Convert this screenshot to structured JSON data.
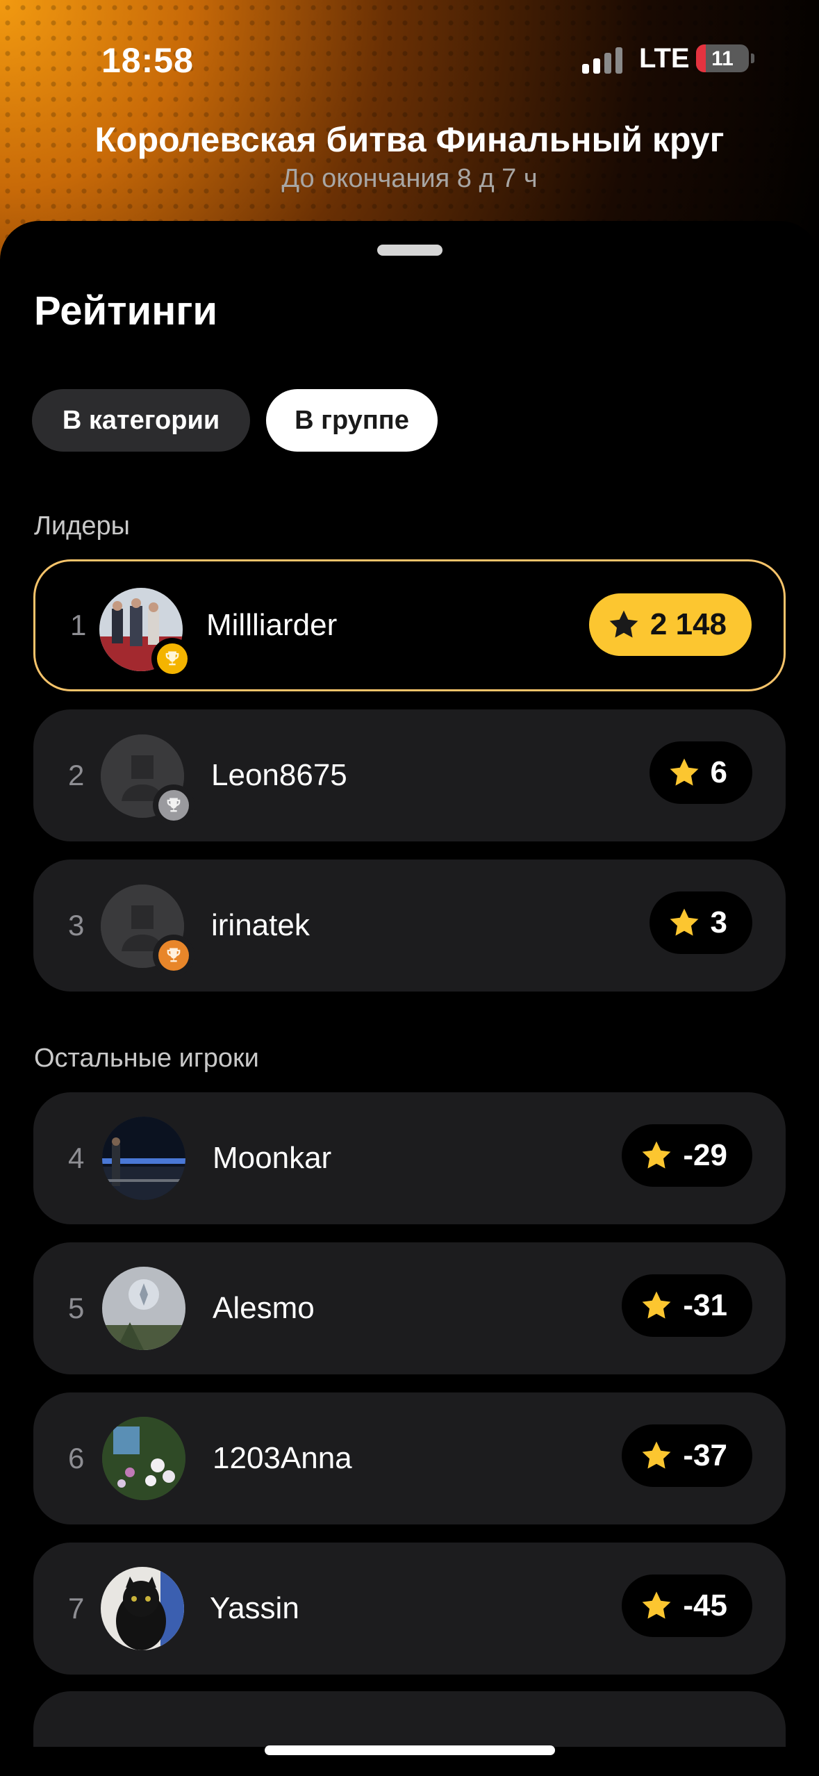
{
  "status_bar": {
    "time": "18:58",
    "network": "LTE",
    "battery_level": "11"
  },
  "event": {
    "title": "Королевская битва Финальный круг",
    "subtitle": "До окончания 8 д 7 ч"
  },
  "sheet": {
    "title": "Рейтинги",
    "tabs": [
      {
        "label": "В категории",
        "selected": false
      },
      {
        "label": "В группе",
        "selected": true
      }
    ]
  },
  "leaders": {
    "label": "Лидеры",
    "rows": [
      {
        "rank": "1",
        "name": "Millliarder",
        "score": "2 148",
        "medal": "gold-trophy-icon"
      },
      {
        "rank": "2",
        "name": "Leon8675",
        "score": "6",
        "medal": "silver-trophy-icon"
      },
      {
        "rank": "3",
        "name": "irinatek",
        "score": "3",
        "medal": "bronze-trophy-icon"
      }
    ]
  },
  "others": {
    "label": "Остальные игроки",
    "rows": [
      {
        "rank": "4",
        "name": "Moonkar",
        "score": "-29"
      },
      {
        "rank": "5",
        "name": "Alesmo",
        "score": "-31"
      },
      {
        "rank": "6",
        "name": "1203Anna",
        "score": "-37"
      },
      {
        "rank": "7",
        "name": "Yassin",
        "score": "-45"
      }
    ]
  },
  "colors": {
    "accent": "#fcc630",
    "leader_border": "#f5c36a",
    "row_bg": "#1c1c1e",
    "battery_low": "#e5333f"
  }
}
